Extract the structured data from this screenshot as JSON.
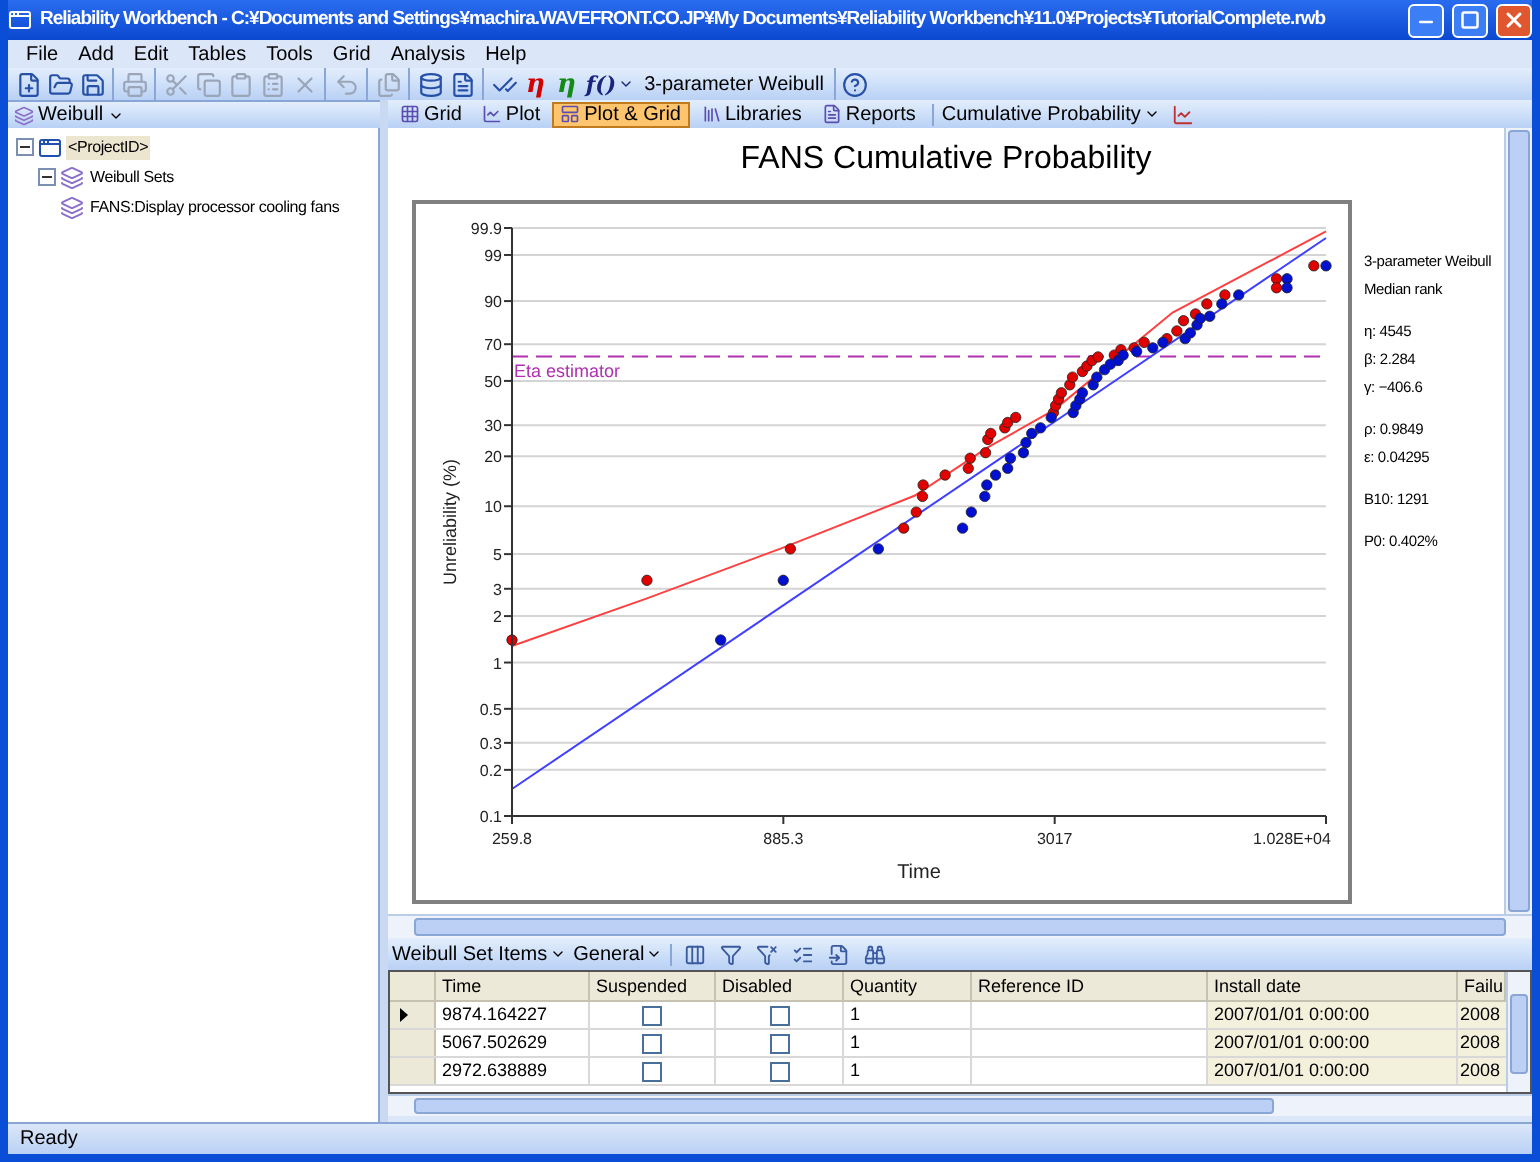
{
  "window": {
    "title": "Reliability Workbench - C:¥Documents and Settings¥machira.WAVEFRONT.CO.JP¥My Documents¥Reliability Workbench¥11.0¥Projects¥TutorialComplete.rwb"
  },
  "menu": [
    "File",
    "Add",
    "Edit",
    "Tables",
    "Tools",
    "Grid",
    "Analysis",
    "Help"
  ],
  "toolbar": [
    [
      {
        "kind": "new",
        "disabled": false
      },
      {
        "kind": "open",
        "disabled": false
      },
      {
        "kind": "save",
        "disabled": false
      }
    ],
    [
      {
        "kind": "print",
        "disabled": true
      }
    ],
    [
      {
        "kind": "cut",
        "disabled": true
      },
      {
        "kind": "copy",
        "disabled": true
      },
      {
        "kind": "paste",
        "disabled": true
      },
      {
        "kind": "paste-special",
        "disabled": true
      },
      {
        "kind": "delete",
        "disabled": true
      }
    ],
    [
      {
        "kind": "undo",
        "disabled": true
      }
    ],
    [
      {
        "kind": "pages",
        "disabled": true
      }
    ],
    [
      {
        "kind": "database",
        "disabled": false
      },
      {
        "kind": "document",
        "disabled": false
      }
    ],
    [
      {
        "kind": "check",
        "disabled": false
      },
      {
        "kind": "symbol",
        "text": "η",
        "color": "#d40000"
      },
      {
        "kind": "symbol",
        "text": "η",
        "color": "#138a13"
      },
      {
        "kind": "function",
        "text": "f()"
      },
      {
        "kind": "label",
        "text": "3-parameter Weibull"
      }
    ],
    [
      {
        "kind": "help",
        "disabled": false
      }
    ]
  ],
  "sidebar": {
    "dropdown": "Weibull",
    "tree": [
      {
        "label": "<ProjectID>",
        "kind": "project",
        "selected": true,
        "expanded": true,
        "children": [
          {
            "label": "Weibull Sets",
            "kind": "set",
            "selected": false,
            "expanded": true,
            "children": [
              {
                "label": "FANS:Display processor cooling fans",
                "kind": "set",
                "selected": false
              }
            ]
          }
        ]
      }
    ]
  },
  "view_tabs": [
    {
      "label": "Grid",
      "kind": "grid",
      "selected": false
    },
    {
      "label": "Plot",
      "kind": "plot",
      "selected": false
    },
    {
      "label": "Plot & Grid",
      "kind": "plotgrid",
      "selected": true
    },
    {
      "label": "Libraries",
      "kind": "libraries",
      "selected": false
    },
    {
      "label": "Reports",
      "kind": "reports",
      "selected": false
    }
  ],
  "plot_type": "Cumulative Probability",
  "chart": {
    "title": "FANS Cumulative Probability",
    "xlabel": "Time",
    "ylabel": "Unreliability (%)",
    "x_tick_labels": [
      "259.8",
      "885.3",
      "3017",
      "1.028E+04"
    ],
    "y_tick_labels": [
      "99.9",
      "99",
      "90",
      "70",
      "50",
      "30",
      "20",
      "10",
      "5",
      "3",
      "2",
      "1",
      "0.5",
      "0.3",
      "0.2",
      "0.1"
    ],
    "reference_line_label": "Eta estimator",
    "fit_summary": [
      {
        "lines": [
          "3-parameter Weibull",
          "Median rank"
        ]
      },
      {
        "lines": [
          "η: 4545",
          "β: 2.284",
          "γ: −406.6"
        ]
      },
      {
        "lines": [
          "ρ: 0.9849",
          "ε: 0.04295"
        ]
      },
      {
        "lines": [
          "B10: 1291"
        ]
      },
      {
        "lines": [
          "P0: 0.402%"
        ]
      }
    ]
  },
  "grid_toolbar": {
    "dropdowns": [
      "Weibull Set Items",
      "General"
    ],
    "tools": [
      {
        "kind": "columns"
      },
      {
        "kind": "filter"
      },
      {
        "kind": "clear-filter"
      },
      {
        "kind": "check-filter"
      },
      {
        "kind": "import"
      },
      {
        "kind": "find"
      }
    ]
  },
  "table": {
    "columns": [
      "Time",
      "Suspended",
      "Disabled",
      "Quantity",
      "Reference ID",
      "Install date",
      "Failu"
    ],
    "rows": [
      {
        "selected": true,
        "time": "9874.164227",
        "suspended": false,
        "disabled": false,
        "quantity": "1",
        "install_date": "2007/01/01 0:00:00",
        "column_7": "2008"
      },
      {
        "selected": false,
        "time": "5067.502629",
        "suspended": false,
        "disabled": false,
        "quantity": "1",
        "install_date": "2007/01/01 0:00:00",
        "column_7": "2008"
      },
      {
        "selected": false,
        "time": "2972.638889",
        "suspended": false,
        "disabled": false,
        "quantity": "1",
        "install_date": "2007/01/01 0:00:00",
        "column_7": "2008"
      }
    ]
  },
  "status_bar": "Ready"
}
